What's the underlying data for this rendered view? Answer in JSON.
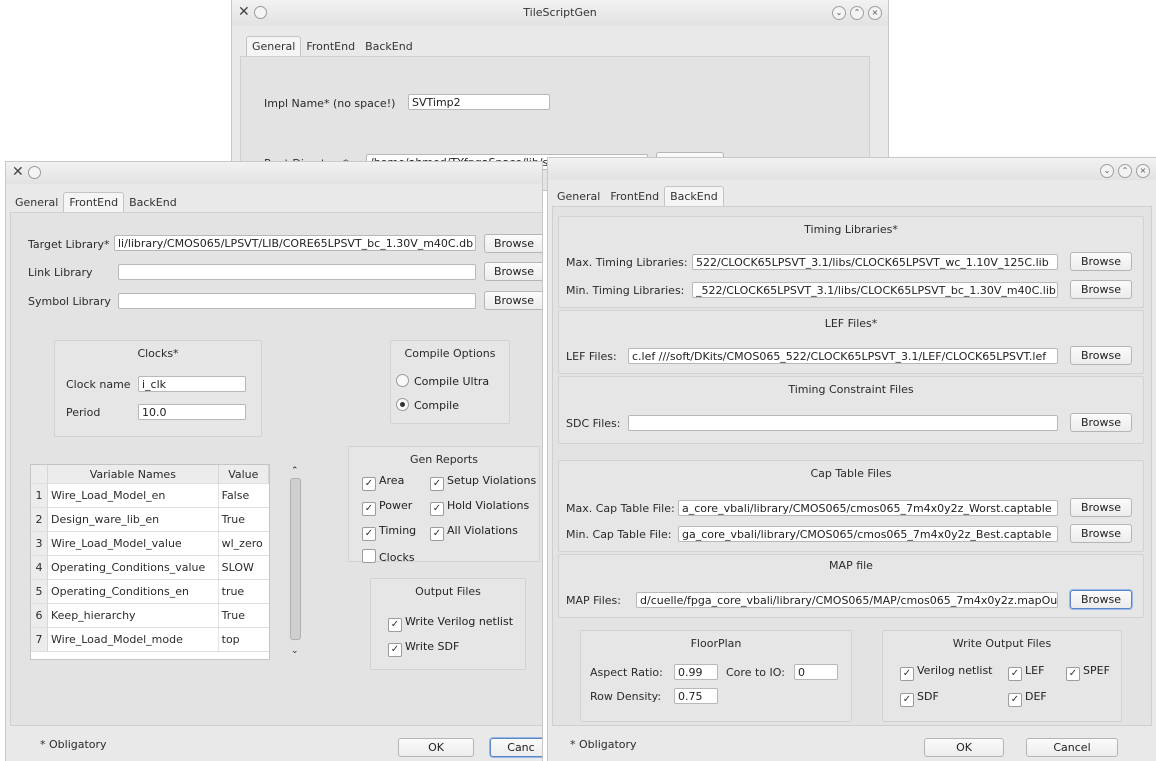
{
  "window_top": {
    "title": "TileScriptGen",
    "tabs": [
      "General",
      "FrontEnd",
      "BackEnd"
    ],
    "impl_name_label": "Impl Name* (no space!)",
    "impl_name_value": "SVTimp2",
    "root_dir_label": "Root Directory*",
    "root_dir_value": "/home/ahmed/TYfpgaSpace/lib/silicon/CTY_Phase",
    "browse": "Browse"
  },
  "window_left": {
    "tabs": [
      "General",
      "FrontEnd",
      "BackEnd"
    ],
    "target_library_label": "Target Library*",
    "target_library_value": "li/library/CMOS065/LPSVT/LIB/CORE65LPSVT_bc_1.30V_m40C.db",
    "link_library_label": "Link Library",
    "link_library_value": "",
    "symbol_library_label": "Symbol Library",
    "symbol_library_value": "",
    "browse": "Browse",
    "clocks": {
      "title": "Clocks*",
      "clock_name_label": "Clock name",
      "clock_name_value": "i_clk",
      "period_label": "Period",
      "period_value": "10.0"
    },
    "compile_options": {
      "title": "Compile Options",
      "compile_ultra": "Compile Ultra",
      "compile": "Compile"
    },
    "table": {
      "headers": [
        "Variable Names",
        "Value"
      ],
      "rows": [
        {
          "n": "1",
          "name": "Wire_Load_Model_en",
          "value": "False"
        },
        {
          "n": "2",
          "name": "Design_ware_lib_en",
          "value": "True"
        },
        {
          "n": "3",
          "name": "Wire_Load_Model_value",
          "value": "wl_zero"
        },
        {
          "n": "4",
          "name": "Operating_Conditions_value",
          "value": "SLOW"
        },
        {
          "n": "5",
          "name": "Operating_Conditions_en",
          "value": "true"
        },
        {
          "n": "6",
          "name": "Keep_hierarchy",
          "value": "True"
        },
        {
          "n": "7",
          "name": "Wire_Load_Model_mode",
          "value": "top"
        }
      ]
    },
    "gen_reports": {
      "title": "Gen Reports",
      "area": "Area",
      "setup_violations": "Setup Violations",
      "power": "Power",
      "hold_violations": "Hold Violations",
      "timing": "Timing",
      "all_violations": "All Violations",
      "clocks": "Clocks"
    },
    "output_files": {
      "title": "Output Files",
      "write_verilog": "Write Verilog netlist",
      "write_sdf": "Write SDF"
    },
    "obligatory": "* Obligatory",
    "ok": "OK",
    "cancel": "Canc"
  },
  "window_right": {
    "tabs": [
      "General",
      "FrontEnd",
      "BackEnd"
    ],
    "browse": "Browse",
    "timing_libraries": {
      "title": "Timing Libraries*",
      "max_label": "Max. Timing Libraries:",
      "max_value": "522/CLOCK65LPSVT_3.1/libs/CLOCK65LPSVT_wc_1.10V_125C.lib",
      "min_label": "Min. Timing Libraries:",
      "min_value": "_522/CLOCK65LPSVT_3.1/libs/CLOCK65LPSVT_bc_1.30V_m40C.lib"
    },
    "lef_files": {
      "title": "LEF Files*",
      "label": "LEF Files:",
      "value": "c.lef ///soft/DKits/CMOS065_522/CLOCK65LPSVT_3.1/LEF/CLOCK65LPSVT.lef"
    },
    "timing_constraints": {
      "title": "Timing Constraint Files",
      "label": "SDC Files:",
      "value": ""
    },
    "cap_table": {
      "title": "Cap Table Files",
      "max_label": "Max. Cap Table File:",
      "max_value": "a_core_vbali/library/CMOS065/cmos065_7m4x0y2z_Worst.captable",
      "min_label": "Min. Cap Table File:",
      "min_value": "ga_core_vbali/library/CMOS065/cmos065_7m4x0y2z_Best.captable"
    },
    "map_file": {
      "title": "MAP file",
      "label": "MAP Files:",
      "value": "d/cuelle/fpga_core_vbali/library/CMOS065/MAP/cmos065_7m4x0y2z.mapOut"
    },
    "floorplan": {
      "title": "FloorPlan",
      "aspect_label": "Aspect Ratio:",
      "aspect_value": "0.99",
      "core_io_label": "Core to IO:",
      "core_io_value": "0",
      "row_density_label": "Row Density:",
      "row_density_value": "0.75"
    },
    "write_output": {
      "title": "Write Output Files",
      "verilog": "Verilog netlist",
      "lef": "LEF",
      "spef": "SPEF",
      "sdf": "SDF",
      "def": "DEF"
    },
    "obligatory": "* Obligatory",
    "ok": "OK",
    "cancel": "Cancel"
  }
}
